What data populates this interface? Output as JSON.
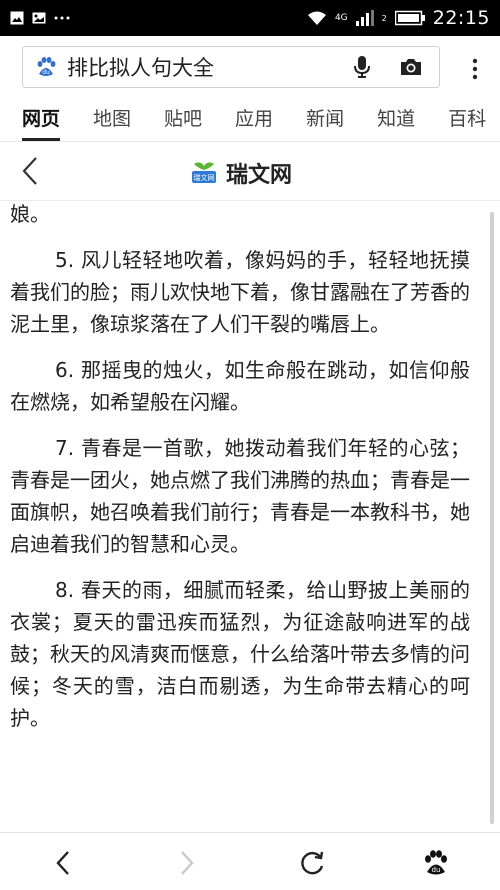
{
  "status_bar": {
    "network_label": "4G",
    "network_sub": "2",
    "time": "22:15",
    "icons": [
      "image-icon",
      "photo-icon",
      "more-dots-icon",
      "wifi-icon",
      "signal-icon",
      "battery-icon"
    ]
  },
  "search": {
    "query": "排比拟人句大全",
    "icons": [
      "baidu-paw-icon",
      "microphone-icon",
      "camera-icon",
      "more-vertical-icon"
    ]
  },
  "tabs": [
    {
      "label": "网页",
      "active": true
    },
    {
      "label": "地图",
      "active": false
    },
    {
      "label": "贴吧",
      "active": false
    },
    {
      "label": "应用",
      "active": false
    },
    {
      "label": "新闻",
      "active": false
    },
    {
      "label": "知道",
      "active": false
    },
    {
      "label": "百科",
      "active": false
    }
  ],
  "site": {
    "name": "瑞文网",
    "logo_text": "瑞文网"
  },
  "article": {
    "paragraphs": [
      {
        "text": "娘。",
        "indent": false
      },
      {
        "text": "5. 风儿轻轻地吹着，像妈妈的手，轻轻地抚摸着我们的脸；雨儿欢快地下着，像甘露融在了芳香的泥土里，像琼浆落在了人们干裂的嘴唇上。",
        "indent": true
      },
      {
        "text": "6. 那摇曳的烛火，如生命般在跳动，如信仰般在燃烧，如希望般在闪耀。",
        "indent": true
      },
      {
        "text": "7. 青春是一首歌，她拨动着我们年轻的心弦；青春是一团火，她点燃了我们沸腾的热血；青春是一面旗帜，她召唤着我们前行；青春是一本教科书，她启迪着我们的智慧和心灵。",
        "indent": true
      },
      {
        "text": "8. 春天的雨，细腻而轻柔，给山野披上美丽的衣裳；夏天的雷迅疾而猛烈，为征途敲响进军的战鼓；秋天的风清爽而惬意，什么给落叶带去多情的问候；冬天的雪，洁白而剔透，为生命带去精心的呵护。",
        "indent": true
      }
    ]
  },
  "bottom_nav": {
    "icons": [
      "back-arrow-icon",
      "forward-arrow-icon",
      "refresh-icon",
      "baidu-paw-icon"
    ]
  },
  "colors": {
    "status_bar_bg": "#000000",
    "text": "#222222",
    "logo_green": "#5cb531",
    "logo_blue": "#2e7bd6"
  }
}
